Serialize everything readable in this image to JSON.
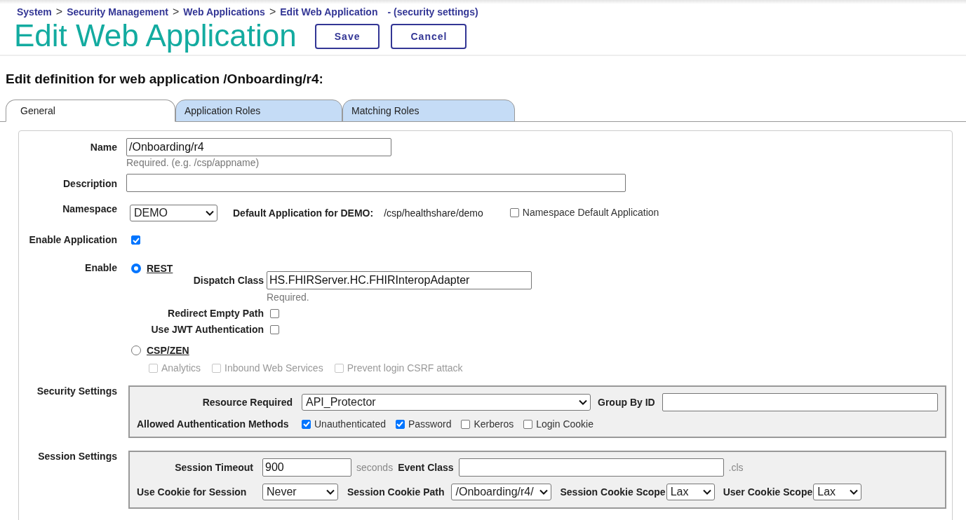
{
  "breadcrumb": {
    "items": [
      {
        "label": "System"
      },
      {
        "label": "Security Management"
      },
      {
        "label": "Web Applications"
      },
      {
        "label": "Edit Web Application"
      }
    ],
    "separator": ">",
    "note": "- (security settings)"
  },
  "page_title": "Edit Web Application",
  "buttons": [
    {
      "label": "Save"
    },
    {
      "label": "Cancel"
    }
  ],
  "heading": "Edit definition for web application /Onboarding/r4:",
  "tabs": [
    {
      "label": "General",
      "selected": true
    },
    {
      "label": "Application Roles",
      "selected": false
    },
    {
      "label": "Matching Roles",
      "selected": false
    }
  ],
  "name": {
    "label": "Name",
    "value": "/Onboarding/r4",
    "hint": "Required. (e.g. /csp/appname)"
  },
  "description": {
    "label": "Description"
  },
  "namespace": {
    "label": "Namespace",
    "value": "DEMO",
    "default_label": "Default Application for DEMO:",
    "default_value": "/csp/healthshare/demo",
    "default_option": {
      "label": "Namespace Default Application",
      "checked": false
    }
  },
  "enable_application": {
    "label": "Enable Application",
    "checked": true
  },
  "enable": {
    "label": "Enable",
    "rest": {
      "label": "REST",
      "selected": true,
      "dispatch_label": "Dispatch Class",
      "dispatch_value": "HS.FHIRServer.HC.FHIRInteropAdapter",
      "dispatch_hint": "Required.",
      "options": [
        {
          "label": "Redirect Empty Path",
          "checked": false
        },
        {
          "label": "Use JWT Authentication",
          "checked": false
        }
      ]
    },
    "csp": {
      "label": "CSP/ZEN",
      "selected": false,
      "options": [
        {
          "label": "Analytics",
          "checked": false,
          "disabled": true
        },
        {
          "label": "Inbound Web Services",
          "checked": false,
          "disabled": true
        },
        {
          "label": "Prevent login CSRF attack",
          "checked": false,
          "disabled": true
        }
      ]
    }
  },
  "security": {
    "label": "Security Settings",
    "resource_label": "Resource Required",
    "resource_value": "API_Protector",
    "group_label": "Group By ID",
    "methods_label": "Allowed Authentication Methods",
    "methods": [
      {
        "label": "Unauthenticated",
        "checked": true
      },
      {
        "label": "Password",
        "checked": true
      },
      {
        "label": "Kerberos",
        "checked": false
      },
      {
        "label": "Login Cookie",
        "checked": false
      }
    ]
  },
  "session": {
    "label": "Session Settings",
    "timeout_label": "Session Timeout",
    "timeout_value": "900",
    "timeout_unit": "seconds",
    "event_label": "Event Class",
    "event_unit": ".cls",
    "selects": [
      {
        "label": "Use Cookie for Session",
        "value": "Never"
      },
      {
        "label": "Session Cookie Path",
        "value": "/Onboarding/r4/"
      },
      {
        "label": "Session Cookie Scope",
        "value": "Lax"
      },
      {
        "label": "User Cookie Scope",
        "value": "Lax"
      }
    ]
  }
}
